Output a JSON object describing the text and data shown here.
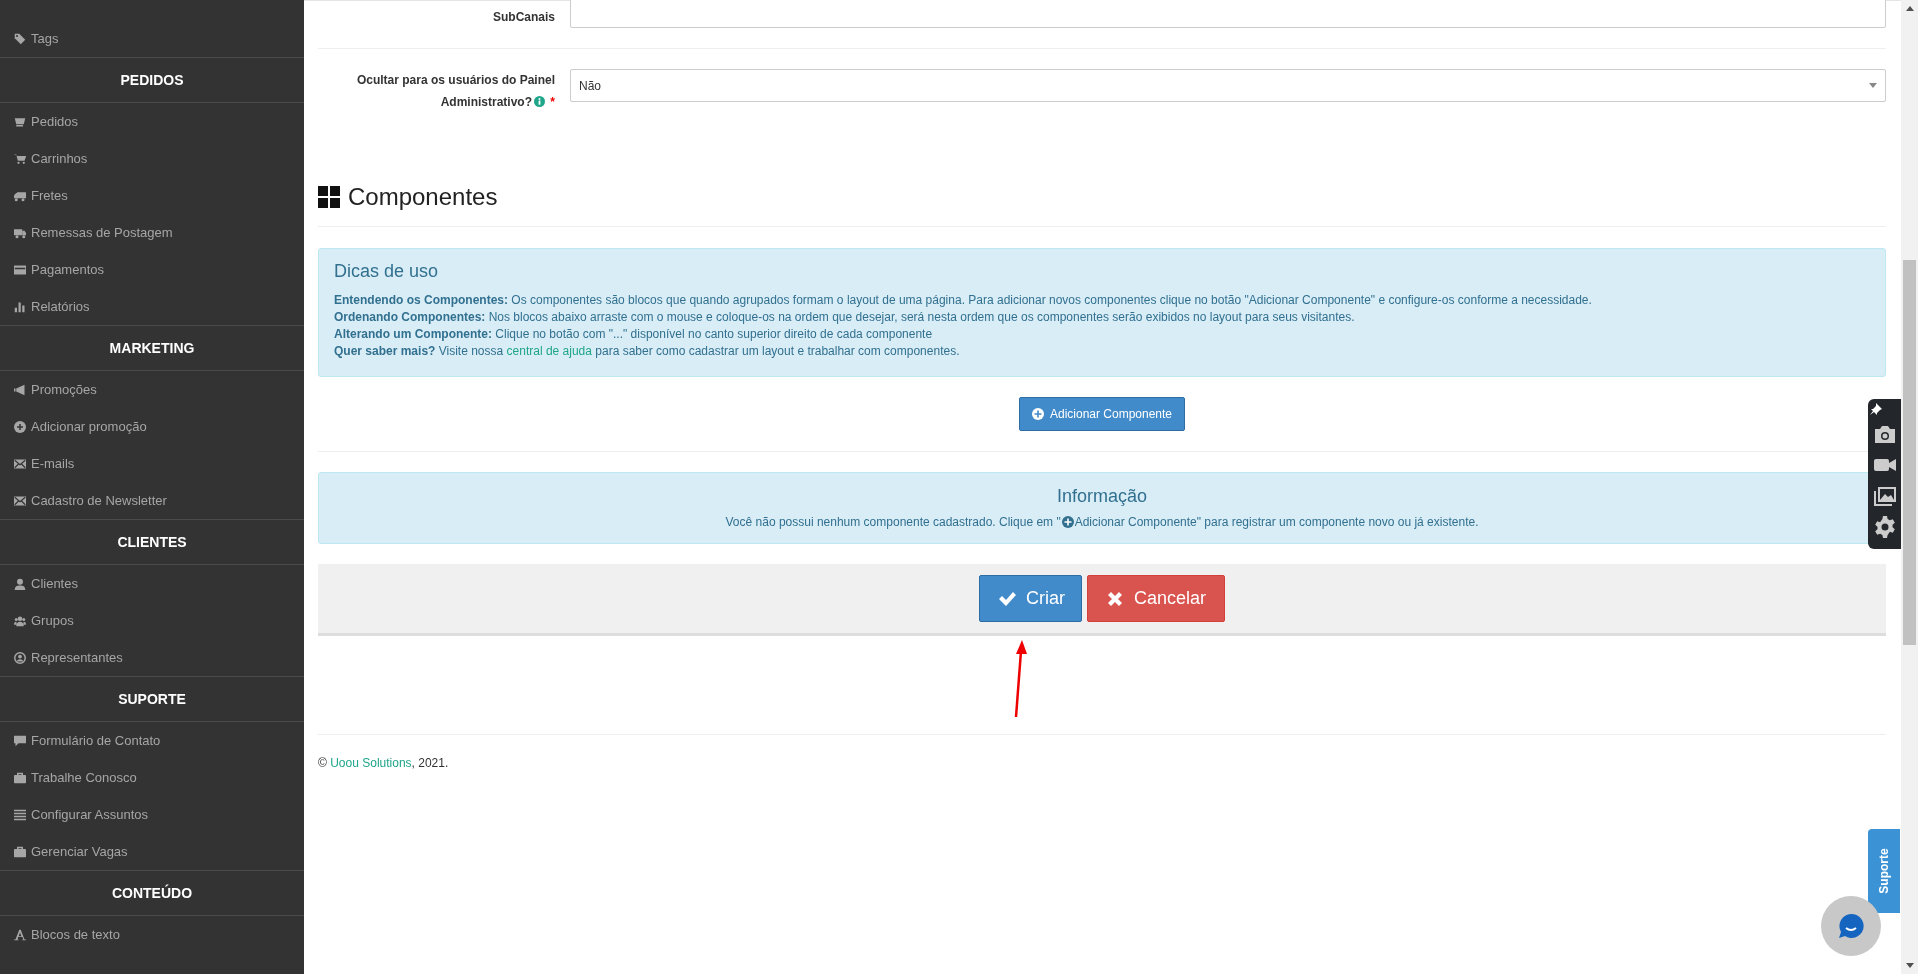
{
  "sidebar": {
    "sections": [
      {
        "items": [
          {
            "label": "Tags"
          }
        ]
      },
      {
        "title": "PEDIDOS",
        "items": [
          {
            "label": "Pedidos"
          },
          {
            "label": "Carrinhos"
          },
          {
            "label": "Fretes"
          },
          {
            "label": "Remessas de Postagem"
          },
          {
            "label": "Pagamentos"
          },
          {
            "label": "Relatórios"
          }
        ]
      },
      {
        "title": "MARKETING",
        "items": [
          {
            "label": "Promoções"
          },
          {
            "label": "Adicionar promoção"
          },
          {
            "label": "E-mails"
          },
          {
            "label": "Cadastro de Newsletter"
          }
        ]
      },
      {
        "title": "CLIENTES",
        "items": [
          {
            "label": "Clientes"
          },
          {
            "label": "Grupos"
          },
          {
            "label": "Representantes"
          }
        ]
      },
      {
        "title": "SUPORTE",
        "items": [
          {
            "label": "Formulário de Contato"
          },
          {
            "label": "Trabalhe Conosco"
          },
          {
            "label": "Configurar Assuntos"
          },
          {
            "label": "Gerenciar Vagas"
          }
        ]
      },
      {
        "title": "CONTEÚDO",
        "items": [
          {
            "label": "Blocos de texto"
          }
        ]
      }
    ]
  },
  "form": {
    "fields": [
      {
        "kind": "text",
        "label": "SubCanais"
      },
      {
        "kind": "select",
        "label": "Ocultar para os usuários do Painel Administrativo?",
        "info": true,
        "required_mark": "*",
        "value": "Não"
      }
    ]
  },
  "components": {
    "title": "Componentes",
    "tips": {
      "title": "Dicas de uso",
      "lines": [
        {
          "text": "**Entendendo os Componentes:** Os componentes são blocos que quando agrupados formam o layout de uma página. Para adicionar novos componentes clique no botão \"Adicionar Componente\" e configure-os conforme a necessidade."
        },
        {
          "text": "**Ordenando Componentes:** Nos blocos abaixo arraste com o mouse e coloque-os na ordem que desejar, será nesta ordem que os componentes serão exibidos no layout para seus visitantes."
        },
        {
          "text": "**Alterando um Componente:** Clique no botão com \"...\" disponível no canto superior direito de cada componente"
        },
        {
          "text": "**Quer saber mais?** Visite nossa ",
          "link": "central de ajuda",
          "text_after": " para saber como cadastrar um layout e trabalhar com componentes."
        }
      ]
    },
    "add_button": "Adicionar Componente",
    "info": {
      "title": "Informação",
      "message_before": "Você não possui nenhum componente cadastrado. Clique em \"",
      "message_after": "Adicionar Componente\" para registrar um componente novo ou já existente."
    }
  },
  "actions": [
    {
      "kind": "primary",
      "label": "Criar"
    },
    {
      "kind": "danger",
      "label": "Cancelar"
    }
  ],
  "footer": {
    "before": "© ",
    "link": "Uoou Solutions",
    "after": ", 2021."
  },
  "support_tab": "Suporte"
}
